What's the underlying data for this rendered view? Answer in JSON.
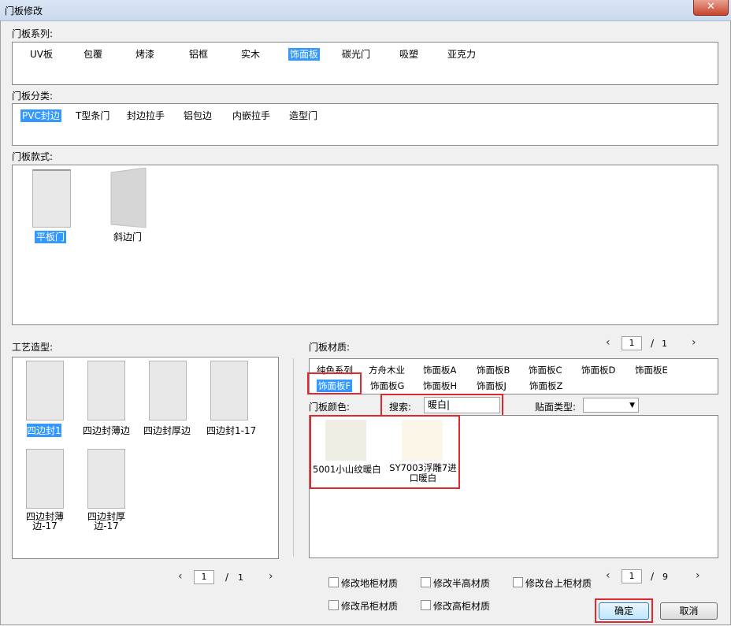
{
  "window": {
    "title": "门板修改",
    "close_label": "✕"
  },
  "series": {
    "label": "门板系列:",
    "items": [
      "UV板",
      "包覆",
      "烤漆",
      "铝框",
      "实木",
      "饰面板",
      "碳光门",
      "吸塑",
      "亚克力"
    ],
    "selected": "饰面板"
  },
  "category": {
    "label": "门板分类:",
    "items": [
      "PVC封边",
      "T型条门",
      "封边拉手",
      "铝包边",
      "内嵌拉手",
      "造型门"
    ],
    "selected": "PVC封边"
  },
  "style": {
    "label": "门板款式:",
    "items": [
      "平板门",
      "斜边门"
    ],
    "selected": "平板门"
  },
  "craft": {
    "label": "工艺造型:",
    "items": [
      "四边封1",
      "四边封薄边",
      "四边封厚边",
      "四边封1-17",
      "四边封薄边-17",
      "四边封厚边-17"
    ],
    "selected": "四边封1",
    "pager": {
      "current": "1",
      "sep": "/",
      "total": "1"
    }
  },
  "material": {
    "label": "门板材质:",
    "pager": {
      "current": "1",
      "sep": "/",
      "total": "1"
    },
    "row1": [
      "纯色系列",
      "方舟木业",
      "饰面板A",
      "饰面板B",
      "饰面板C",
      "饰面板D",
      "饰面板E"
    ],
    "row2": [
      "饰面板F",
      "饰面板G",
      "饰面板H",
      "饰面板J",
      "饰面板Z"
    ],
    "selected": "饰面板F"
  },
  "color": {
    "label": "门板颜色:",
    "search_label": "搜索:",
    "search_value": "暖白|",
    "veneer_label": "贴面类型:",
    "veneer_value": "",
    "items": [
      "5001小山纹暖白",
      "SY7003浮雕7进口暖白"
    ],
    "pager": {
      "current": "1",
      "sep": "/",
      "total": "9"
    }
  },
  "options": {
    "items": [
      "修改地柜材质",
      "修改半高材质",
      "修改台上柜材质",
      "修改吊柜材质",
      "修改高柜材质"
    ]
  },
  "buttons": {
    "ok": "确定",
    "cancel": "取消"
  },
  "colors": {
    "selection": "#3399ff",
    "highlight_box": "#e0282f"
  }
}
